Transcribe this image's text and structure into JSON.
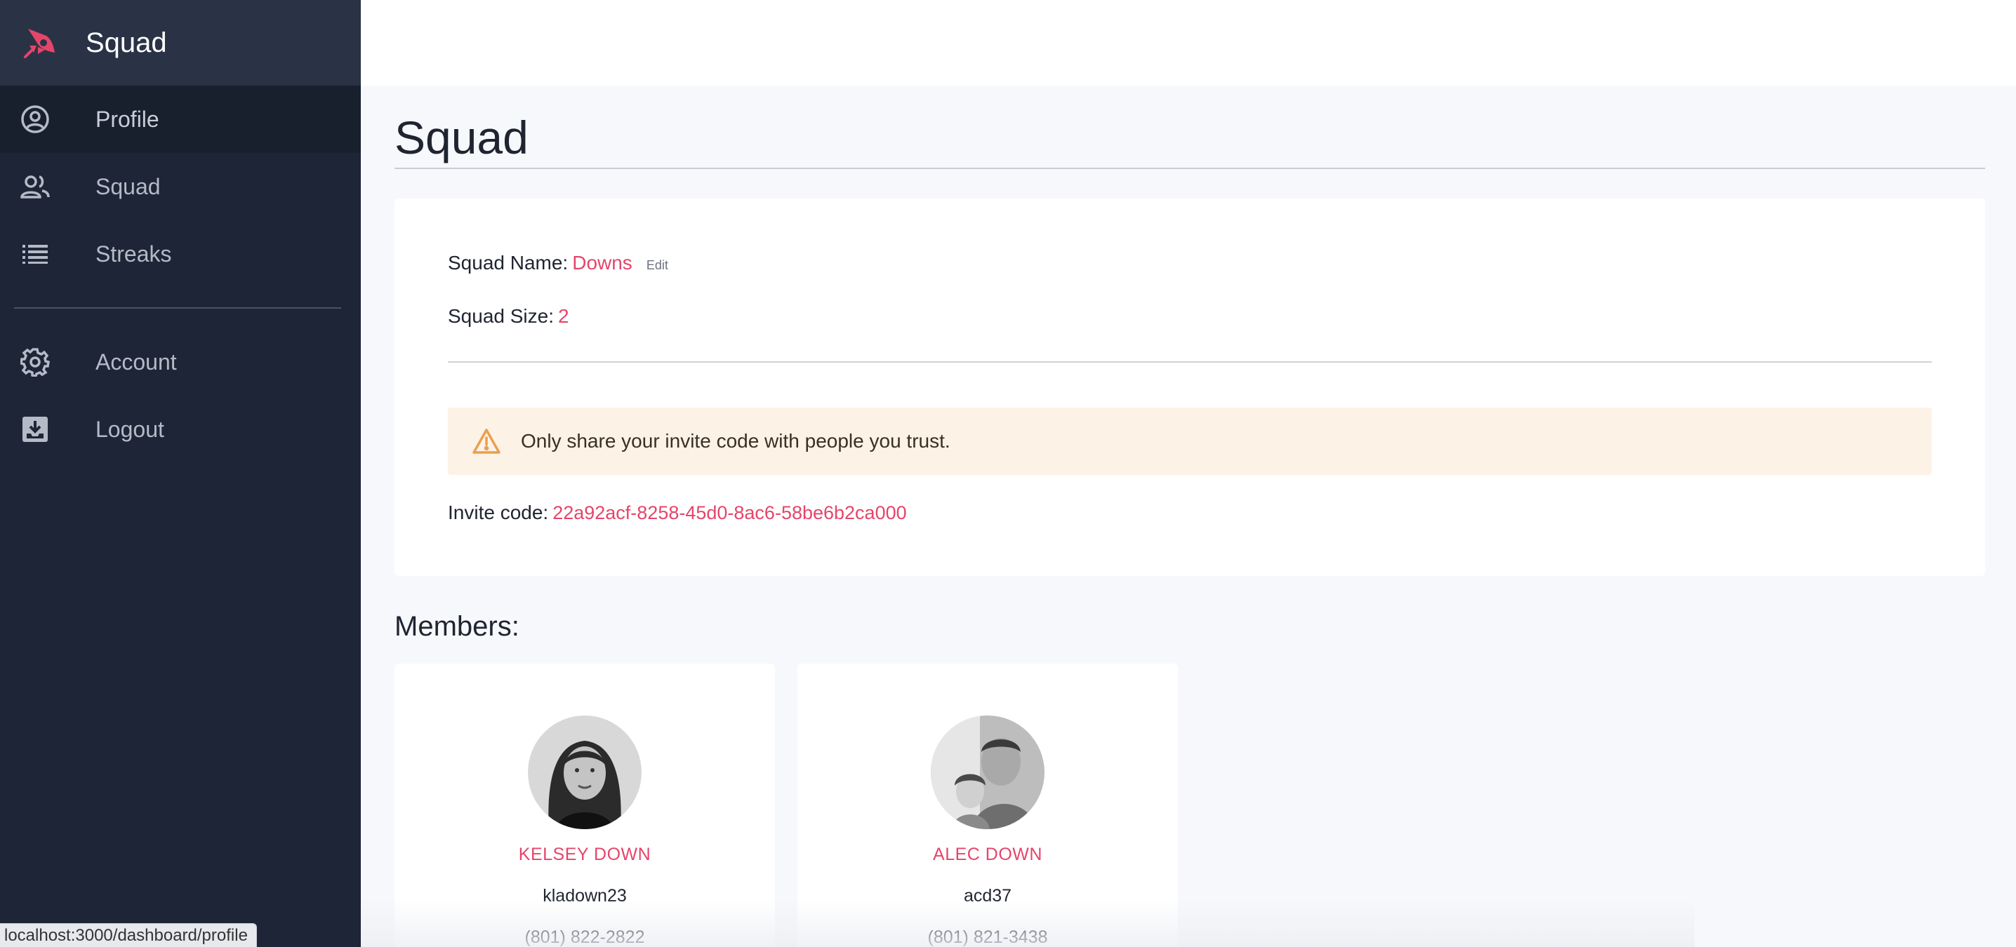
{
  "brand": {
    "title": "Squad",
    "logo_icon": "rocket-icon",
    "accent": "#e5456a"
  },
  "sidebar": {
    "items": [
      {
        "label": "Profile",
        "icon": "user-circle-icon"
      },
      {
        "label": "Squad",
        "icon": "users-icon"
      },
      {
        "label": "Streaks",
        "icon": "list-icon"
      }
    ],
    "secondary": [
      {
        "label": "Account",
        "icon": "gear-icon"
      },
      {
        "label": "Logout",
        "icon": "logout-icon"
      }
    ]
  },
  "page": {
    "title": "Squad"
  },
  "squad": {
    "name_label": "Squad Name:",
    "name_value": "Downs",
    "edit_label": "Edit",
    "size_label": "Squad Size:",
    "size_value": "2"
  },
  "alert": {
    "text": "Only share your invite code with people you trust.",
    "icon": "warning-icon",
    "color": "#e9a04f"
  },
  "invite": {
    "label": "Invite code:",
    "code": "22a92acf-8258-45d0-8ac6-58be6b2ca000"
  },
  "members": {
    "title": "Members:",
    "list": [
      {
        "name": "KELSEY DOWN",
        "username": "kladown23",
        "phone": "(801) 822-2822"
      },
      {
        "name": "ALEC DOWN",
        "username": "acd37",
        "phone": "(801) 821-3438"
      }
    ]
  },
  "status_bar": {
    "url": "localhost:3000/dashboard/profile"
  }
}
